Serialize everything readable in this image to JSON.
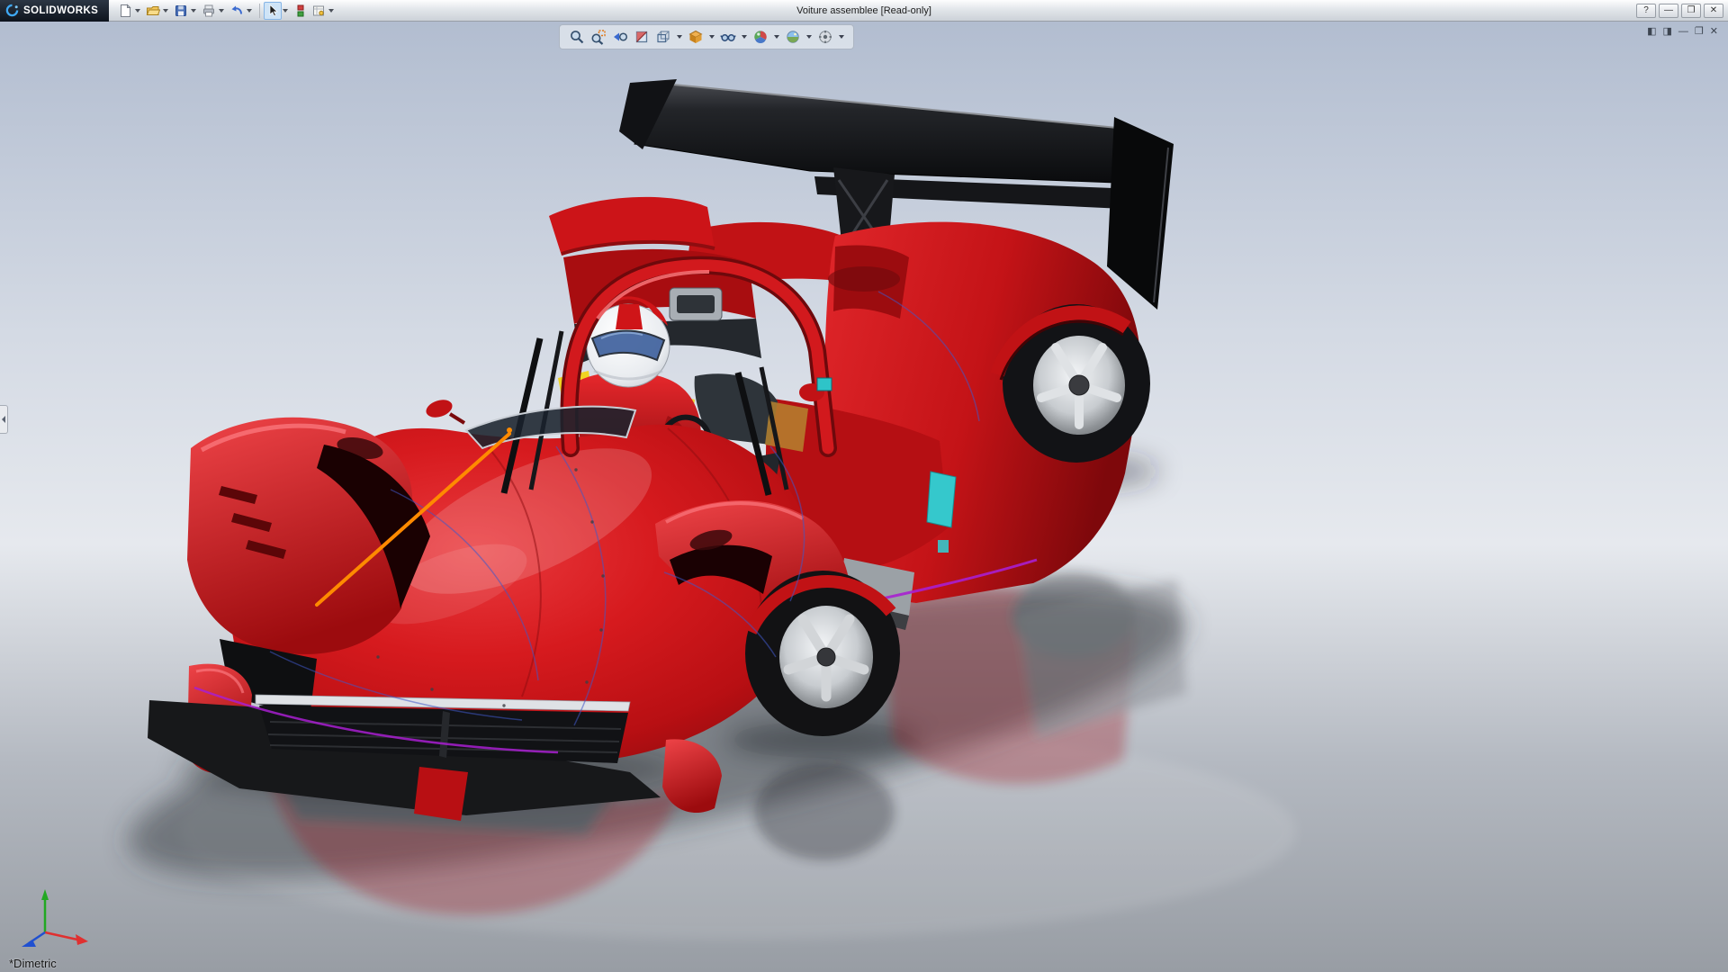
{
  "window": {
    "brand": "SOLIDWORKS",
    "title": "Voiture assemblee [Read-only]",
    "controls": {
      "help": "?",
      "minimize": "—",
      "maximize": "❐",
      "close": "✕"
    }
  },
  "main_toolbar": {
    "items": [
      "new-document",
      "open",
      "save",
      "print",
      "undo",
      "select",
      "component-display",
      "sheet-options"
    ]
  },
  "heads_up_toolbar": {
    "items": [
      "zoom-to-fit",
      "zoom-to-area",
      "previous-view",
      "section-view",
      "view-orientation",
      "display-style",
      "hide-show-items",
      "edit-appearance",
      "apply-scene",
      "view-settings"
    ]
  },
  "document_controls": {
    "items": [
      {
        "name": "cascade-document",
        "glyph": "◧"
      },
      {
        "name": "tile-document",
        "glyph": "◨"
      },
      {
        "name": "minimize-document",
        "glyph": "—"
      },
      {
        "name": "restore-document",
        "glyph": "❐"
      },
      {
        "name": "close-document",
        "glyph": "✕"
      }
    ]
  },
  "viewport": {
    "view_label": "*Dimetric"
  },
  "colors": {
    "body_red": "#d01316",
    "wing_black": "#0c0c0e",
    "accent_orange": "#ff8a00",
    "trim_purple": "#a81fd0",
    "accent_teal": "#35c8cc",
    "background_top": "#b2bdd0",
    "floor_grey": "#989da4",
    "triad_x": "#e03030",
    "triad_y": "#22a822",
    "triad_z": "#2050d0"
  }
}
